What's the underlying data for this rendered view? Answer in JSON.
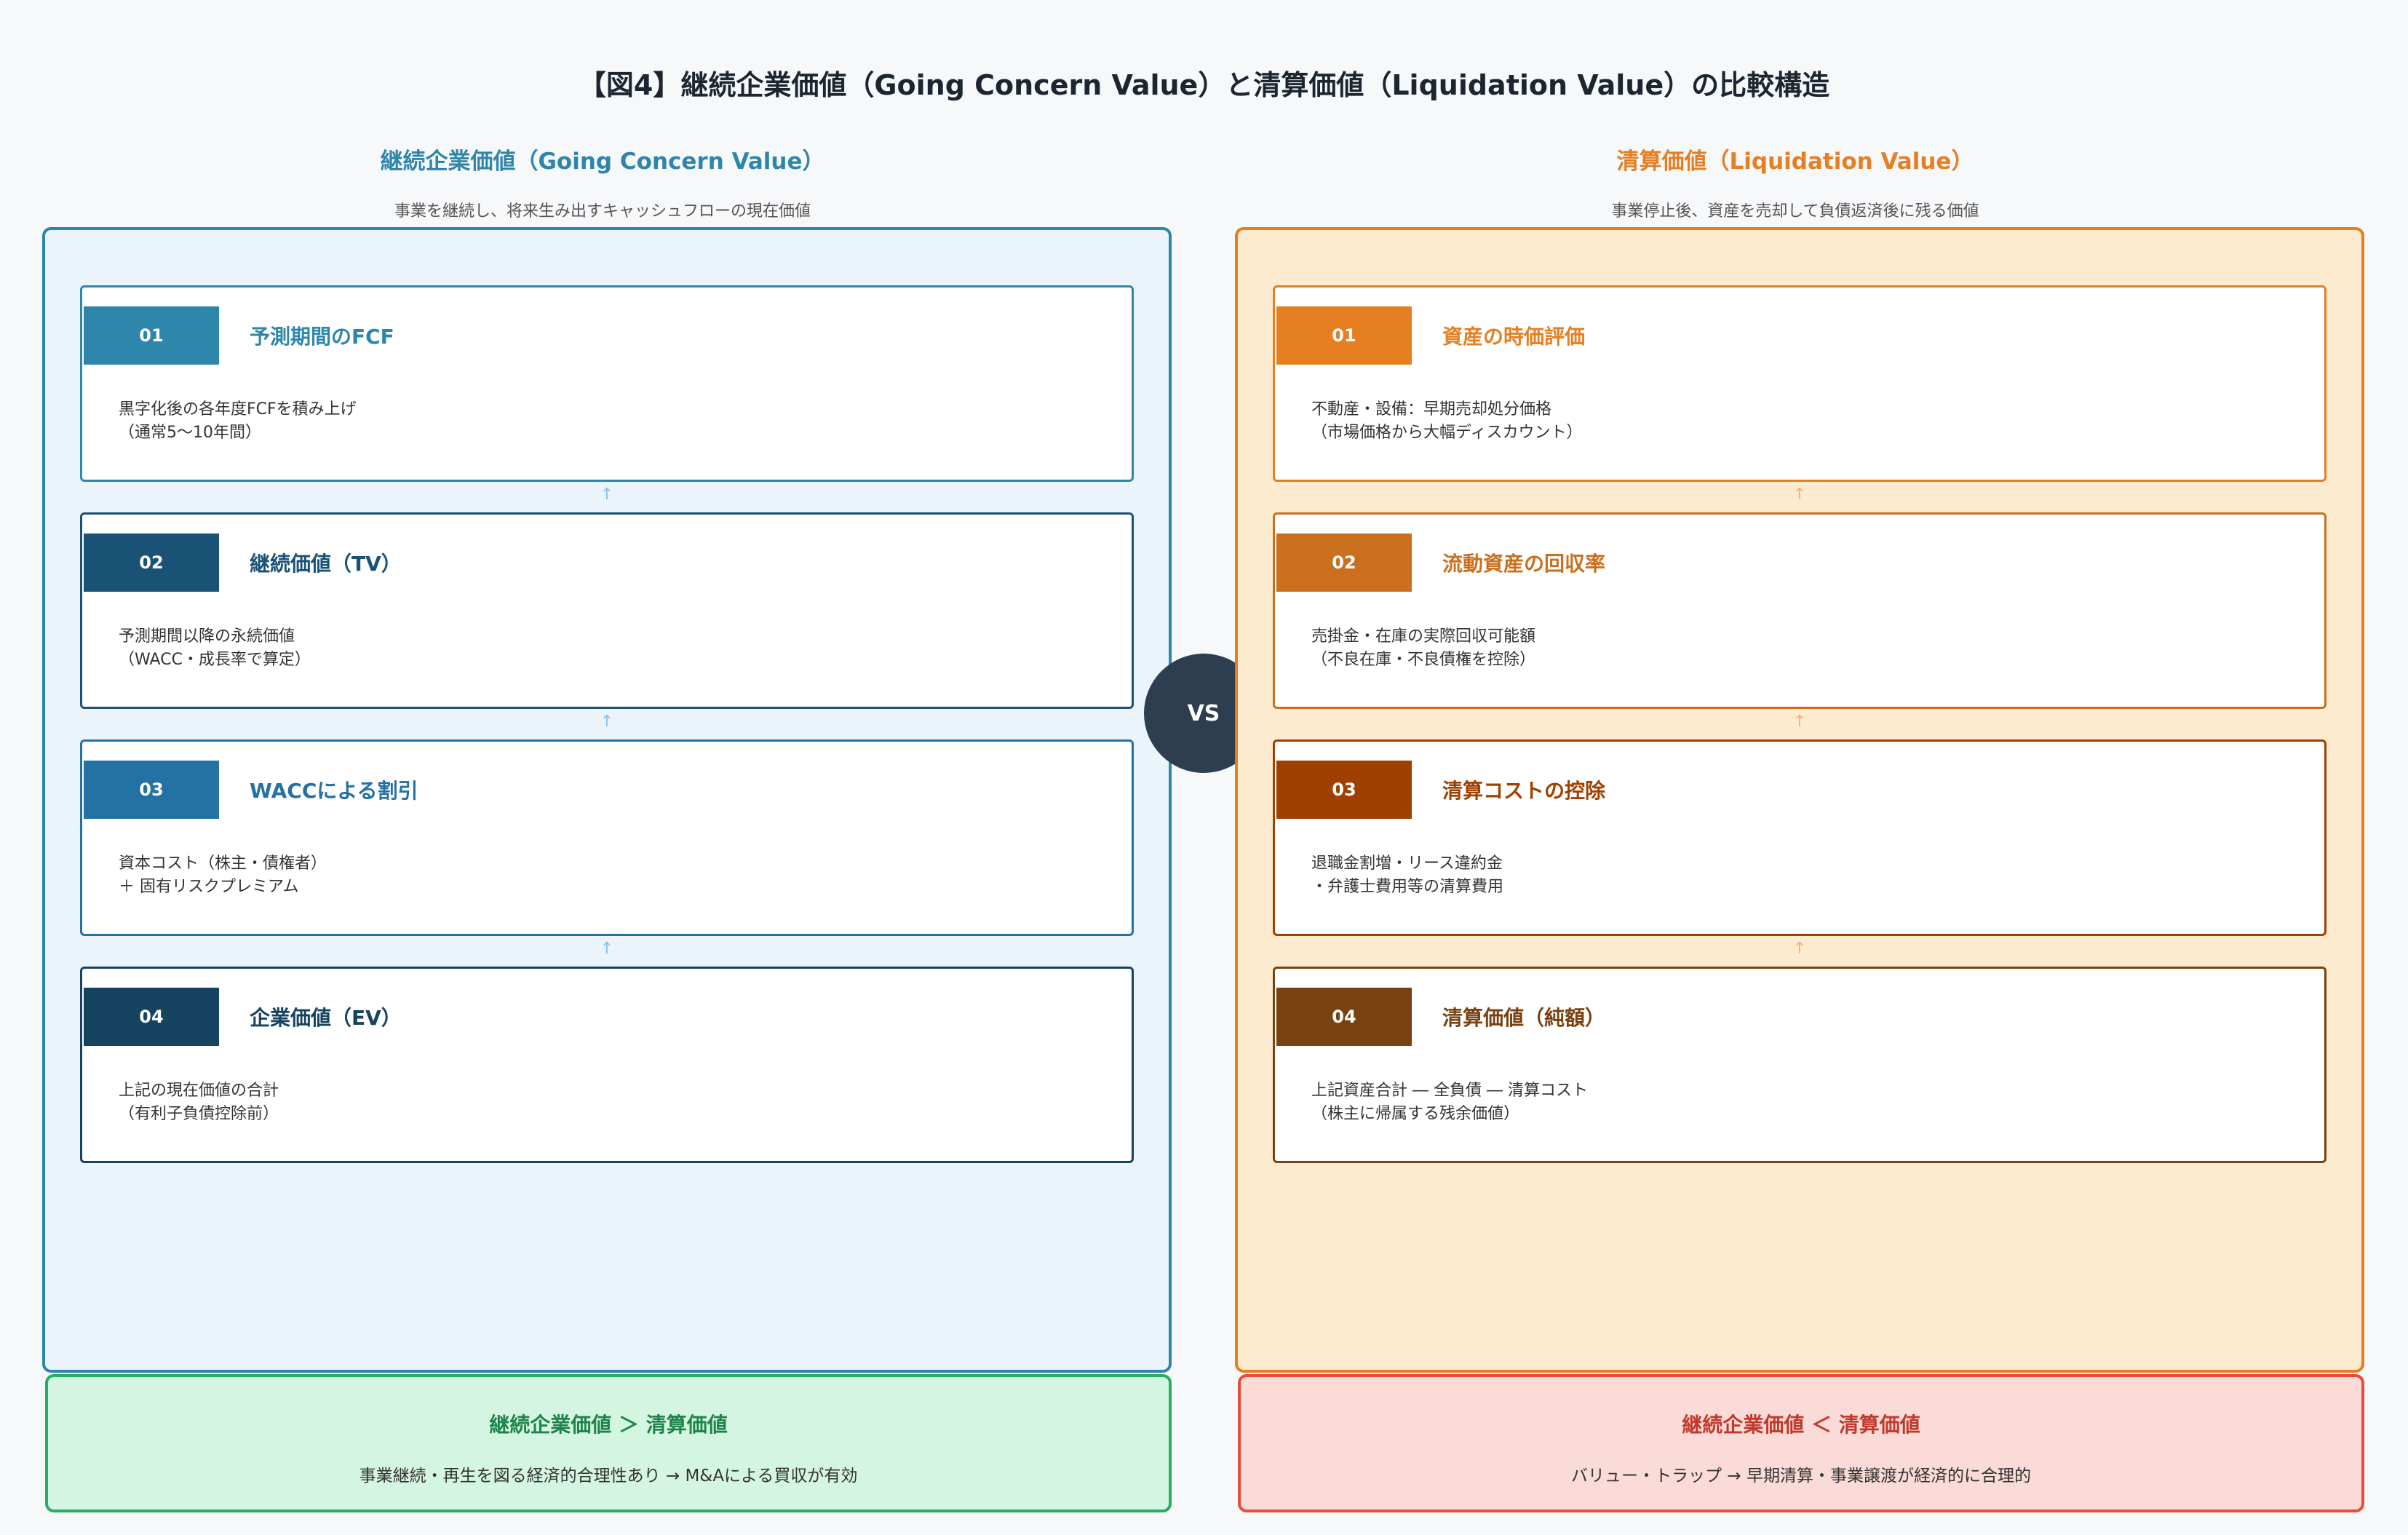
{
  "title": "【図4】継続企業価値（Going Concern Value）と清算価値（Liquidation Value）の比較構造",
  "vs_label": "VS",
  "colors": {
    "left_accent": "#2e86ab",
    "left_panel_bg": "#ebf4fb",
    "right_accent": "#e67e22",
    "right_panel_bg": "#fdebd0",
    "vs_bg": "#2c3e50",
    "good_bg": "#d5f5e3",
    "good_border": "#27ae60",
    "good_text": "#1e8449",
    "bad_bg": "#fadbd8",
    "bad_border": "#e74c3c",
    "bad_text": "#c0392b"
  },
  "left": {
    "heading": "継続企業価値（Going Concern Value）",
    "subheading": "事業を継続し、将来生み出すキャッシュフローの現在価値",
    "steps": [
      {
        "num": "01",
        "title": "予測期間のFCF",
        "desc": "黒字化後の各年度FCFを積み上げ\n（通常5〜10年間）",
        "color": "#2e86ab"
      },
      {
        "num": "02",
        "title": "継続価値（TV）",
        "desc": "予測期間以降の永続価値\n（WACC・成長率で算定）",
        "color": "#1a5276"
      },
      {
        "num": "03",
        "title": "WACCによる割引",
        "desc": "資本コスト（株主・債権者）\n＋ 固有リスクプレミアム",
        "color": "#2471a3"
      },
      {
        "num": "04",
        "title": "企業価値（EV）",
        "desc": "上記の現在価値の合計\n（有利子負債控除前）",
        "color": "#154360"
      }
    ],
    "verdict": {
      "title": "継続企業価値 ＞ 清算価値",
      "desc": "事業継続・再生を図る経済的合理性あり → M&Aによる買収が有効"
    }
  },
  "right": {
    "heading": "清算価値（Liquidation Value）",
    "subheading": "事業停止後、資産を売却して負債返済後に残る価値",
    "steps": [
      {
        "num": "01",
        "title": "資産の時価評価",
        "desc": "不動産・設備：早期売却処分価格\n（市場価格から大幅ディスカウント）",
        "color": "#e67e22"
      },
      {
        "num": "02",
        "title": "流動資産の回収率",
        "desc": "売掛金・在庫の実際回収可能額\n（不良在庫・不良債権を控除）",
        "color": "#ca6f1e"
      },
      {
        "num": "03",
        "title": "清算コストの控除",
        "desc": "退職金割増・リース違約金\n・弁護士費用等の清算費用",
        "color": "#a04000"
      },
      {
        "num": "04",
        "title": "清算価値（純額）",
        "desc": "上記資産合計 ― 全負債 ― 清算コスト\n（株主に帰属する残余価値）",
        "color": "#784212"
      }
    ],
    "verdict": {
      "title": "継続企業価値 ＜ 清算価値",
      "desc": "バリュー・トラップ → 早期清算・事業譲渡が経済的に合理的"
    }
  }
}
